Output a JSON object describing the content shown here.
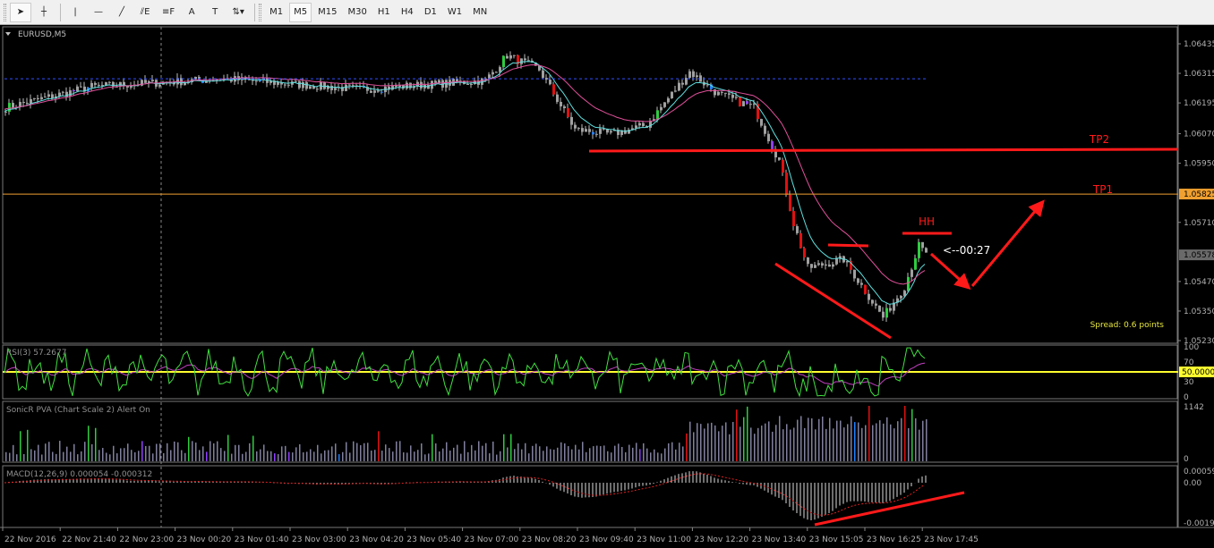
{
  "toolbar": {
    "tools": [
      {
        "name": "cursor-icon",
        "glyph": "➤"
      },
      {
        "name": "crosshair-icon",
        "glyph": "┼"
      },
      {
        "name": "vertical-line-icon",
        "glyph": "|"
      },
      {
        "name": "horizontal-line-icon",
        "glyph": "—"
      },
      {
        "name": "trendline-icon",
        "glyph": "╱"
      },
      {
        "name": "equidistant-channel-icon",
        "glyph": "⫽E"
      },
      {
        "name": "fibonacci-icon",
        "glyph": "≡F"
      },
      {
        "name": "text-icon",
        "glyph": "A"
      },
      {
        "name": "text-label-icon",
        "glyph": "T"
      },
      {
        "name": "arrows-icon",
        "glyph": "⇅▾"
      }
    ],
    "timeframes": [
      "M1",
      "M5",
      "M15",
      "M30",
      "H1",
      "H4",
      "D1",
      "W1",
      "MN"
    ],
    "active_timeframe": "M5"
  },
  "main": {
    "symbol_label": "EURUSD,M5",
    "price_ticks": [
      "1.06435",
      "1.06315",
      "1.06195",
      "1.06070",
      "1.05950",
      "1.05825",
      "1.05710",
      "1.05578",
      "1.05470",
      "1.05350",
      "1.05230"
    ],
    "tp1_price_label": "1.05825",
    "current_price_label": "1.05578",
    "annotations": {
      "tp2": "TP2",
      "tp1": "TP1",
      "hh": "HH",
      "countdown": "<--00:27",
      "spread": "Spread: 0.6 points"
    },
    "colors": {
      "bull": "#2ecc40",
      "bear": "#e01010",
      "neutral": "#a0a0a0",
      "ma_fast": "#5fe0e0",
      "ma_slow": "#e0509a",
      "tp1": "#f0a030",
      "annotation": "#ff1a1a",
      "grid_blue": "#3050ff",
      "spread_text": "#e8e840"
    }
  },
  "chart_data": {
    "type": "candlestick",
    "approx_close_path": [
      [
        0,
        1.06177
      ],
      [
        24,
        1.06261
      ],
      [
        61,
        1.06293
      ],
      [
        99,
        1.0625
      ],
      [
        134,
        1.06286
      ],
      [
        140,
        1.06388
      ],
      [
        149,
        1.0633
      ],
      [
        159,
        1.06087
      ],
      [
        169,
        1.06068
      ],
      [
        179,
        1.06105
      ],
      [
        191,
        1.06322
      ],
      [
        199,
        1.0623
      ],
      [
        209,
        1.06177
      ],
      [
        216,
        1.0596
      ],
      [
        220,
        1.05705
      ],
      [
        224,
        1.05524
      ],
      [
        234,
        1.0556
      ],
      [
        245,
        1.05324
      ],
      [
        251,
        1.0545
      ],
      [
        255,
        1.05615
      ],
      [
        257,
        1.05578
      ]
    ],
    "dashed_level": 1.06293,
    "tp2_level": 1.06,
    "tp1_level": 1.05825
  },
  "rsi": {
    "label": "RSI(3) 57.2677",
    "ticks": [
      "100",
      "70",
      "50.0000",
      "30",
      "0"
    ],
    "level_color": "#ffff30",
    "line_color": "#40e040",
    "signal_color": "#c040c0"
  },
  "volume": {
    "label": "SonicR PVA  (Chart Scale 2)   Alert On",
    "ticks": [
      "1142",
      "0"
    ]
  },
  "macd": {
    "label": "MACD(12,26,9) 0.000054 -0.000312",
    "ticks": [
      "0.00059",
      "0.00",
      "-0.0019"
    ]
  },
  "time_axis": [
    "22 Nov 2016",
    "22 Nov 21:40",
    "22 Nov 23:00",
    "23 Nov 00:20",
    "23 Nov 01:40",
    "23 Nov 03:00",
    "23 Nov 04:20",
    "23 Nov 05:40",
    "23 Nov 07:00",
    "23 Nov 08:20",
    "23 Nov 09:40",
    "23 Nov 11:00",
    "23 Nov 12:20",
    "23 Nov 13:40",
    "23 Nov 15:05",
    "23 Nov 16:25",
    "23 Nov 17:45"
  ]
}
